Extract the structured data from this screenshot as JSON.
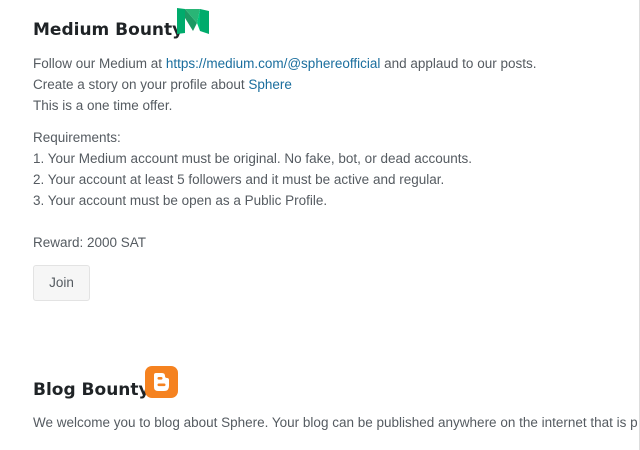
{
  "medium": {
    "title": "Medium Bounty",
    "logo_icon": "medium-logo-icon",
    "logo_color": "#00ab6c",
    "line1_pre": "Follow our Medium at ",
    "line1_link": "https://medium.com/@sphereofficial",
    "line1_post": " and applaud to our posts.",
    "line2_pre": "Create a story on your profile about ",
    "line2_link": "Sphere",
    "line3": "This is a one time offer.",
    "requirements_heading": "Requirements:",
    "requirements": [
      "1. Your Medium account must be original. No fake, bot, or dead accounts.",
      "2. Your account at least 5 followers and it must be active and regular.",
      "3. Your account must be open as a Public Profile."
    ],
    "reward": "Reward: 2000 SAT",
    "join_label": "Join"
  },
  "blog": {
    "title": "Blog Bounty",
    "logo_icon": "blogger-logo-icon",
    "logo_color": "#f57d00",
    "description": "We welcome you to blog about Sphere. Your blog can be published anywhere on the internet that is p"
  },
  "colors": {
    "link": "#1a6e9e",
    "heading": "#1f2326",
    "body_text": "#555b61"
  }
}
